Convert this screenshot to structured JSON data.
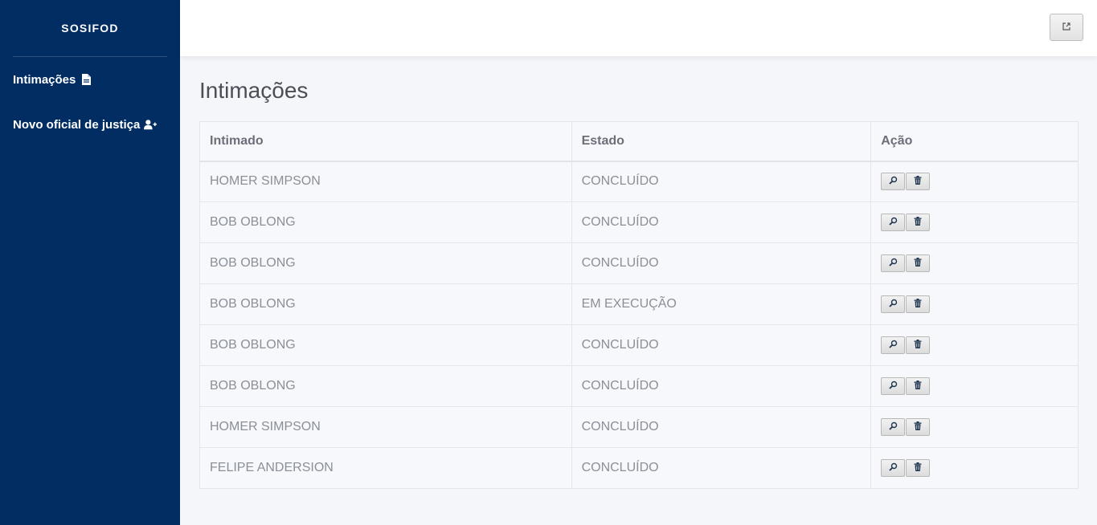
{
  "sidebar": {
    "brand": "SOSIFOD",
    "items": [
      {
        "label": "Intimações",
        "icon": "file-icon"
      },
      {
        "label": "Novo oficial de justiça",
        "icon": "user-plus-icon"
      }
    ]
  },
  "topbar": {
    "button_icon": "external-link-icon"
  },
  "page": {
    "title": "Intimações"
  },
  "table": {
    "headers": [
      "Intimado",
      "Estado",
      "Ação"
    ],
    "rows": [
      {
        "intimado": "HOMER SIMPSON",
        "estado": "CONCLUÍDO"
      },
      {
        "intimado": "BOB OBLONG",
        "estado": "CONCLUÍDO"
      },
      {
        "intimado": "BOB OBLONG",
        "estado": "CONCLUÍDO"
      },
      {
        "intimado": "BOB OBLONG",
        "estado": "EM EXECUÇÃO"
      },
      {
        "intimado": "BOB OBLONG",
        "estado": "CONCLUÍDO"
      },
      {
        "intimado": "BOB OBLONG",
        "estado": "CONCLUÍDO"
      },
      {
        "intimado": "HOMER SIMPSON",
        "estado": "CONCLUÍDO"
      },
      {
        "intimado": "FELIPE ANDERSION",
        "estado": "CONCLUÍDO"
      }
    ],
    "action_icons": [
      "search-icon",
      "trash-icon"
    ]
  },
  "colors": {
    "sidebar": "#012d63",
    "background": "#f5f6fa",
    "text": "#8a8f98"
  }
}
